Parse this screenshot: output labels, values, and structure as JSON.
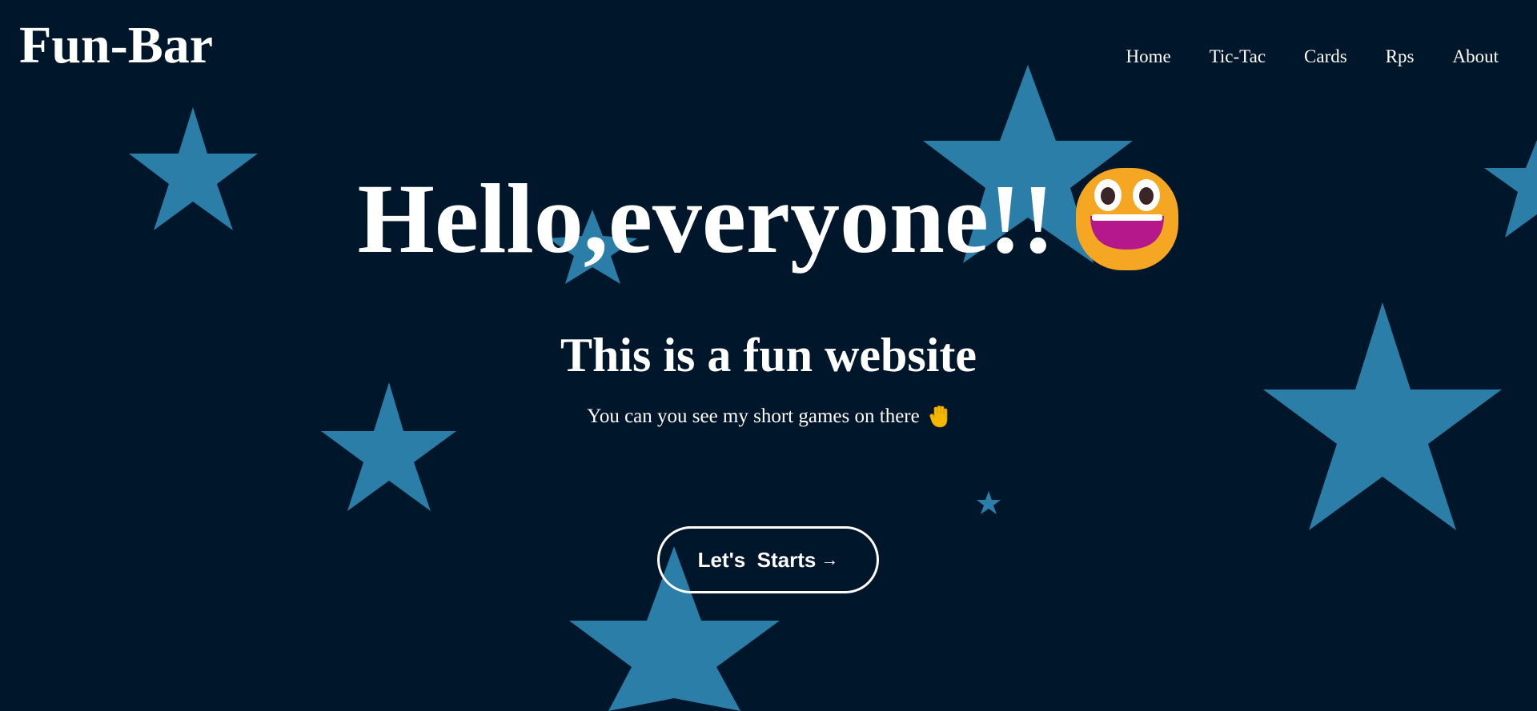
{
  "header": {
    "logo": "Fun-Bar",
    "nav": [
      {
        "label": "Home"
      },
      {
        "label": "Tic-Tac"
      },
      {
        "label": "Cards"
      },
      {
        "label": "Rps"
      },
      {
        "label": "About"
      }
    ]
  },
  "hero": {
    "title": "Hello,everyone!!",
    "title_icon": "grinning-face-icon",
    "subtitle": "This is a fun website",
    "subtext": "You can you see my short games on there",
    "subtext_icon": "raised-hand-icon",
    "cta_label": "Let's  Starts",
    "cta_icon": "arrow-right-icon"
  },
  "colors": {
    "background": "#00172b",
    "star": "#2a7ea8",
    "text": "#ffffff",
    "emoji_face": "#f5a623",
    "emoji_mouth": "#b5188a"
  }
}
